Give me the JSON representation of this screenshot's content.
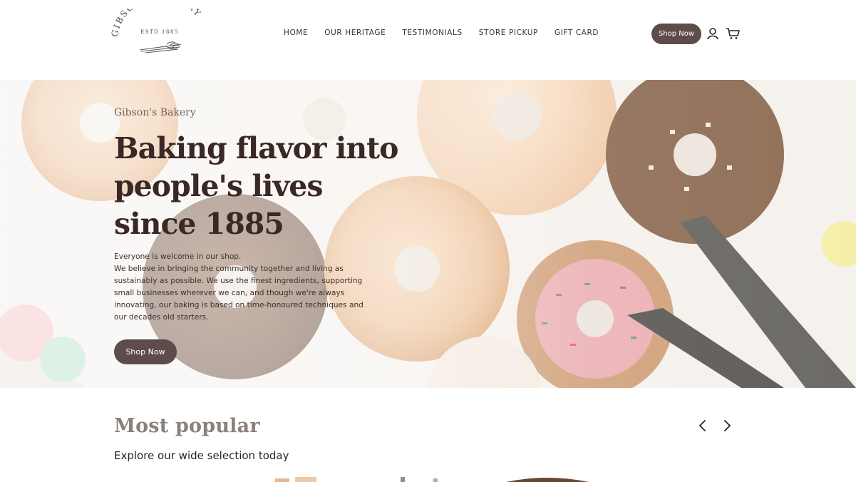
{
  "header": {
    "logo": {
      "name": "GIBSON'S BAKERY",
      "tagline": "ESTD 1885"
    },
    "nav": [
      {
        "label": "HOME"
      },
      {
        "label": "OUR HERITAGE"
      },
      {
        "label": "TESTIMONIALS"
      },
      {
        "label": "STORE PICKUP"
      },
      {
        "label": "GIFT CARD"
      }
    ],
    "shop_button": "Shop Now",
    "icons": {
      "account": "user-icon",
      "cart": "cart-icon"
    }
  },
  "hero": {
    "eyebrow": "Gibson's Bakery",
    "title_lines": [
      "Baking flavor into",
      "people's lives",
      "since 1885"
    ],
    "body_lines": [
      "Everyone is welcome in our shop.",
      "We believe in bringing the community together and living as",
      "sustainably as possible. We use the finest ingredients, supporting",
      "small businesses wherever we can, and though we're always",
      "innovating, our baking is based on time-honoured techniques and",
      "our decades old starters."
    ],
    "button": "Shop Now"
  },
  "popular": {
    "title": "Most popular",
    "subtitle": "Explore our wide selection today",
    "icons": {
      "prev": "chevron-left-icon",
      "next": "chevron-right-icon"
    }
  },
  "colors": {
    "accent": "#5e4c4a",
    "title": "#3a2826",
    "text": "#2b2321"
  }
}
